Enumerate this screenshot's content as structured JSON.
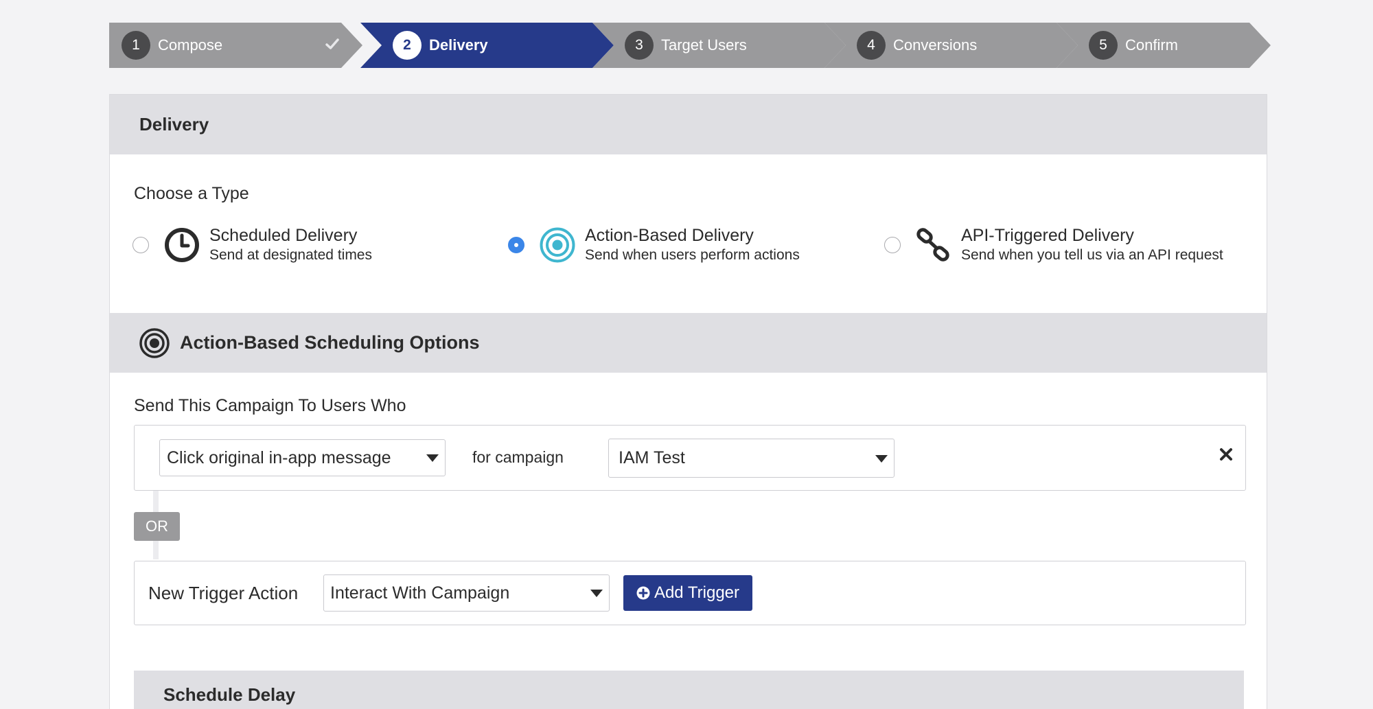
{
  "steps": [
    {
      "num": "1",
      "label": "Compose",
      "state": "done"
    },
    {
      "num": "2",
      "label": "Delivery",
      "state": "active"
    },
    {
      "num": "3",
      "label": "Target Users",
      "state": "upcoming"
    },
    {
      "num": "4",
      "label": "Conversions",
      "state": "upcoming"
    },
    {
      "num": "5",
      "label": "Confirm",
      "state": "upcoming"
    }
  ],
  "panel": {
    "title": "Delivery",
    "choose_title": "Choose a Type",
    "types": [
      {
        "title": "Scheduled Delivery",
        "subtitle": "Send at designated times",
        "icon": "clock-icon",
        "selected": false
      },
      {
        "title": "Action-Based Delivery",
        "subtitle": "Send when users perform actions",
        "icon": "target-icon",
        "selected": true
      },
      {
        "title": "API-Triggered Delivery",
        "subtitle": "Send when you tell us via an API request",
        "icon": "link-icon",
        "selected": false
      }
    ]
  },
  "scheduling": {
    "title": "Action-Based Scheduling Options",
    "send_title": "Send This Campaign To Users Who",
    "trigger": {
      "action": "Click original in-app message",
      "for_label": "for campaign",
      "campaign": "IAM Test"
    },
    "or_label": "OR",
    "new_trigger": {
      "label": "New Trigger Action",
      "value": "Interact With Campaign",
      "add_button": "Add Trigger"
    },
    "delay_title": "Schedule Delay"
  },
  "colors": {
    "active_step": "#263a8a",
    "inactive_step": "#9a9a9c",
    "radio_selected": "#3b86e8",
    "target_icon": "#3fb6cf",
    "band": "#dfdfe3"
  }
}
